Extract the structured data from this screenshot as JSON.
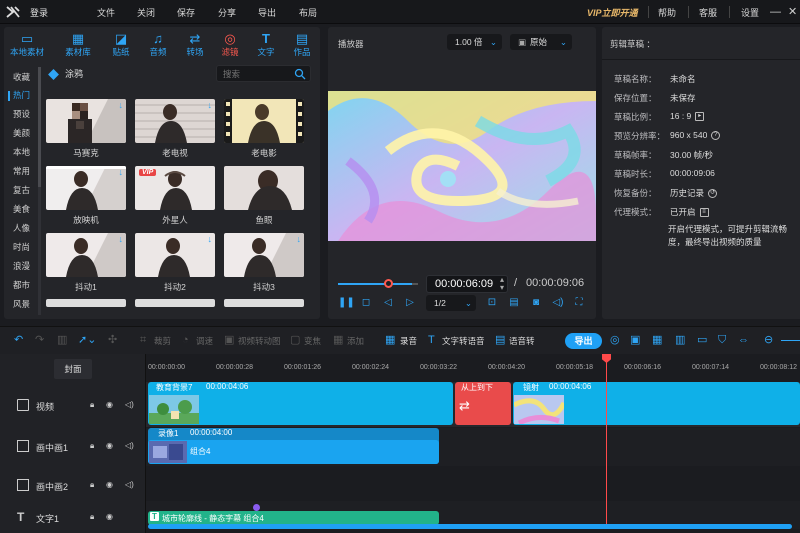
{
  "topbar": {
    "login": "登录",
    "menu": [
      "文件",
      "关闭",
      "保存",
      "分享",
      "导出",
      "布局"
    ],
    "vip": "VIP立即开通",
    "links": [
      "帮助",
      "客服",
      "设置"
    ]
  },
  "tools": [
    {
      "label": "本地素材",
      "icon": "folder-icon"
    },
    {
      "label": "素材库",
      "icon": "film-library-icon"
    },
    {
      "label": "贴纸",
      "icon": "sticker-icon"
    },
    {
      "label": "音频",
      "icon": "music-icon"
    },
    {
      "label": "转场",
      "icon": "transition-icon"
    },
    {
      "label": "滤镜",
      "icon": "filter-icon"
    },
    {
      "label": "文字",
      "icon": "text-icon"
    },
    {
      "label": "作品",
      "icon": "works-icon"
    }
  ],
  "active_tool": "滤镜",
  "categories": [
    "收藏",
    "热门",
    "预设",
    "美颜",
    "本地",
    "常用",
    "复古",
    "美食",
    "人像",
    "时尚",
    "浪漫",
    "都市",
    "风景"
  ],
  "active_category": "热门",
  "filter_header": "涂鸦",
  "search": {
    "placeholder": "搜索",
    "value": ""
  },
  "filters": [
    {
      "name": "马赛克",
      "vip": false
    },
    {
      "name": "老电视",
      "vip": false
    },
    {
      "name": "老电影",
      "vip": false
    },
    {
      "name": "放映机",
      "vip": false
    },
    {
      "name": "外星人",
      "vip": true,
      "vip_label": "VIP"
    },
    {
      "name": "鱼眼",
      "vip": false
    },
    {
      "name": "抖动1",
      "vip": false
    },
    {
      "name": "抖动2",
      "vip": false
    },
    {
      "name": "抖动3",
      "vip": false
    }
  ],
  "player": {
    "title": "播放器",
    "speed": "1.00 倍",
    "aspect": "原始",
    "current_time": "00:00:06:09",
    "total_time": "00:00:09:06",
    "separator": "/",
    "ratio": "1/2",
    "progress": 0.68
  },
  "draft": {
    "title": "剪辑草稿 ：",
    "rows": [
      {
        "label": "草稿名称：",
        "value": "未命名"
      },
      {
        "label": "保存位置：",
        "value": "未保存"
      },
      {
        "label": "草稿比例：",
        "value": "16 : 9"
      },
      {
        "label": "预览分辨率：",
        "value": "960 x 540"
      },
      {
        "label": "草稿帧率：",
        "value": "30.00 帧/秒"
      },
      {
        "label": "草稿时长：",
        "value": "00:00:09:06"
      },
      {
        "label": "恢复备份：",
        "value": "历史记录"
      },
      {
        "label": "代理模式：",
        "value": "已开启"
      }
    ],
    "proxy_note": "开启代理模式，可提升剪辑流畅度，最终导出视频的质量"
  },
  "timeline_tools": [
    {
      "label": "裁剪",
      "on": false
    },
    {
      "label": "调速",
      "on": false
    },
    {
      "label": "视频转动图",
      "on": false
    },
    {
      "label": "变焦",
      "on": false
    },
    {
      "label": "添加",
      "on": false
    },
    {
      "label": "录音",
      "on": true
    },
    {
      "label": "文字转语音",
      "on": true
    },
    {
      "label": "语音转",
      "on": true
    }
  ],
  "export_label": "导出",
  "cover_label": "封面",
  "ruler": [
    "00:00:00:00",
    "00:00:00:28",
    "00:00:01:26",
    "00:00:02:24",
    "00:00:03:22",
    "00:00:04:20",
    "00:00:05:18",
    "00:00:06:16",
    "00:00:07:14",
    "00:00:08:12"
  ],
  "tracks": [
    {
      "name": "视频"
    },
    {
      "name": "画中画1"
    },
    {
      "name": "画中画2"
    },
    {
      "name": "文字1"
    }
  ],
  "clips": {
    "video1": {
      "name": "教育背景7",
      "duration": "00:00:04:06"
    },
    "transition": {
      "name": "从上到下"
    },
    "video2": {
      "name": "镜射",
      "duration": "00:00:04:06"
    },
    "pip": {
      "name": "录像1",
      "duration": "00:00:04:00",
      "group": "组合4"
    },
    "text": {
      "content": "城市轮廓线 - 静态字幕 组合4"
    }
  },
  "colors": {
    "accent": "#1fa0f5",
    "active": "#ff5a50",
    "vip": "#e8b86a",
    "text_clip": "#22b38a"
  }
}
